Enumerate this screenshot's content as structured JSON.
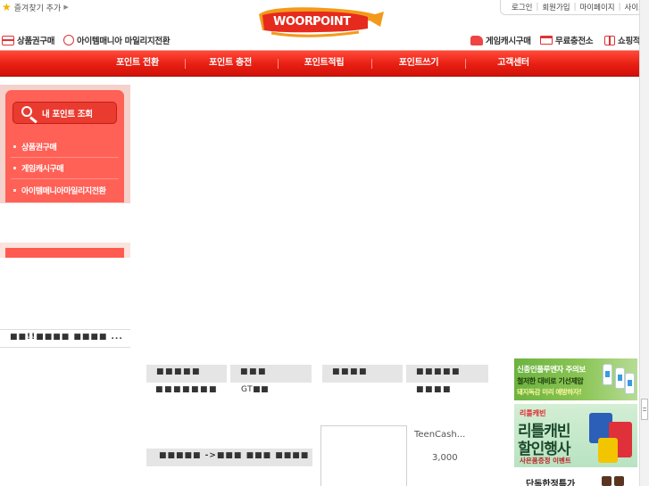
{
  "top": {
    "favorite_label": "즐겨찾기 추가",
    "util_links": [
      "로그인",
      "회원가입",
      "마이페이지",
      "사이트맵"
    ]
  },
  "logo": {
    "word1": "WOORI",
    "word2": "POINT"
  },
  "subnav_left": [
    {
      "icon": "card-icon",
      "label": "상품권구매"
    },
    {
      "icon": "coin-icon",
      "label": "아이템매니아 마일리지전환"
    }
  ],
  "subnav_right": [
    {
      "icon": "hand-icon",
      "label": "게임캐시구매"
    },
    {
      "icon": "cart-icon",
      "label": "무료충전소"
    },
    {
      "icon": "gift-icon",
      "label": "쇼핑적"
    }
  ],
  "main_menu": [
    "포인트 전환",
    "포인트 충전",
    "포인트적립",
    "포인트쓰기",
    "고객센터"
  ],
  "sidebar": {
    "lookup_label": "내 포인트 조회",
    "items": [
      "상품권구매",
      "게임캐시구매",
      "아이템매니아마일리지전환"
    ]
  },
  "notice_text": "■■!!■■■■ ■■■■ ...",
  "content": {
    "blocks": [
      "■■■■■",
      "■■■",
      "■■■■",
      "■■■■■"
    ],
    "subs": [
      "■■■■■■■",
      "GT■■",
      "■■■■"
    ],
    "block_wide": "■■■■■ ->■■■ ■■■ ■■■■",
    "product_name": "TeenCash...",
    "product_price": "3,000"
  },
  "banners": {
    "flu": {
      "line1": "신종인플루엔자 주의보",
      "line2": "철저한 대비로 기선제압",
      "line3": "돼지독감 미리 예방하자!"
    },
    "little": {
      "tag": "리틀캐빈",
      "big1": "리틀캐빈",
      "big2": "할인행사",
      "small": "사은품증정 이벤트"
    },
    "special_label": "단독한정특가"
  },
  "colors": {
    "menu_red": "#e81e12",
    "sidebar_red": "#ff6157",
    "banner_green": "#6cb340"
  }
}
